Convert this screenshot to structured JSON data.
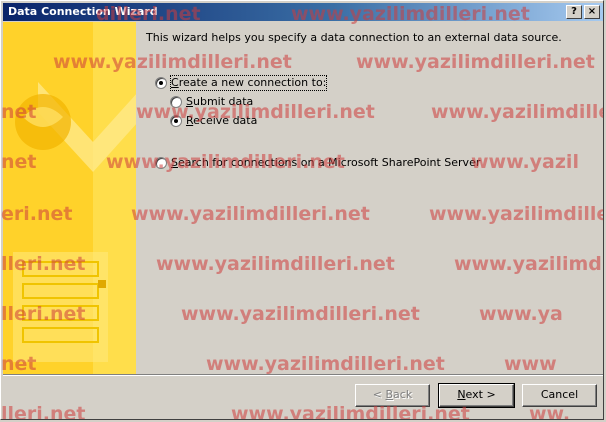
{
  "window": {
    "title": "Data Connection Wizard",
    "help_button": "?",
    "close_button": "×"
  },
  "intro": "This wizard helps you specify a data connection to an external data source.",
  "options": {
    "create_label_prefix": "C",
    "create_label_rest": "reate a new connection to:",
    "submit_prefix": "S",
    "submit_rest": "ubmit data",
    "receive_prefix": "R",
    "receive_rest": "eceive data",
    "search_prefix": "S",
    "search_rest": "earch for connections on a Microsoft SharePoint Server",
    "create_selected": true,
    "receive_selected": true
  },
  "buttons": {
    "back_prefix": "< ",
    "back_key": "B",
    "back_rest": "ack",
    "next_key": "N",
    "next_rest": "ext >",
    "cancel": "Cancel"
  },
  "watermark": {
    "text": "www.yazilimdilleri.net",
    "fragment_net": "net",
    "fragment_eri": "eri.net",
    "fragment_lleri": "lleri.net",
    "fragment_illeri": "dilleri.net",
    "fragment_www": "www",
    "fragment_www_ya": "www.ya",
    "fragment_yazil": "www.yazil",
    "fragment_ww": "ww.",
    "color": "#cd3c3c"
  }
}
